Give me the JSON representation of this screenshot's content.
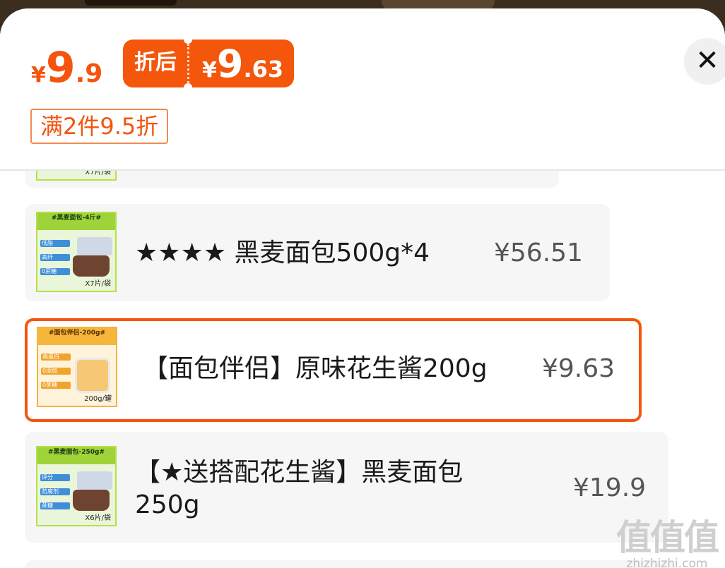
{
  "header": {
    "original_price": {
      "currency": "¥",
      "integer": "9",
      "decimal": ".9"
    },
    "after_discount": {
      "label": "折后",
      "currency": "¥",
      "integer": "9",
      "decimal": ".63"
    },
    "promo_tag": "满2件9.5折",
    "close_icon": "close-icon"
  },
  "items": [
    {
      "thumb_footer": "X7片/袋"
    },
    {
      "title": "★★★★ 黑麦面包500g*4",
      "price": "¥56.51",
      "thumb": {
        "header": "#黑麦面包-4斤#",
        "chips": [
          "低脂",
          "高纤",
          "0蔗糖"
        ],
        "footer": "X7片/袋"
      }
    },
    {
      "title": "【面包伴侣】原味花生酱200g",
      "price": "¥9.63",
      "selected": true,
      "thumb": {
        "header": "#面包伴侣-200g#",
        "chips": [
          "高蛋白",
          "0添加",
          "0蔗糖"
        ],
        "footer": "200g/罐"
      }
    },
    {
      "title_line1": "【★送搭配花生酱】黑麦面包",
      "title_line2": "250g",
      "price": "¥19.9",
      "thumb": {
        "header": "#黑麦面包-250g#",
        "chips": [
          "评分",
          "防腐剂",
          "蔗糖"
        ],
        "footer": "X6片/袋"
      }
    }
  ],
  "watermark": {
    "glyphs": "值值值",
    "url": "zhizhizhi.com"
  }
}
